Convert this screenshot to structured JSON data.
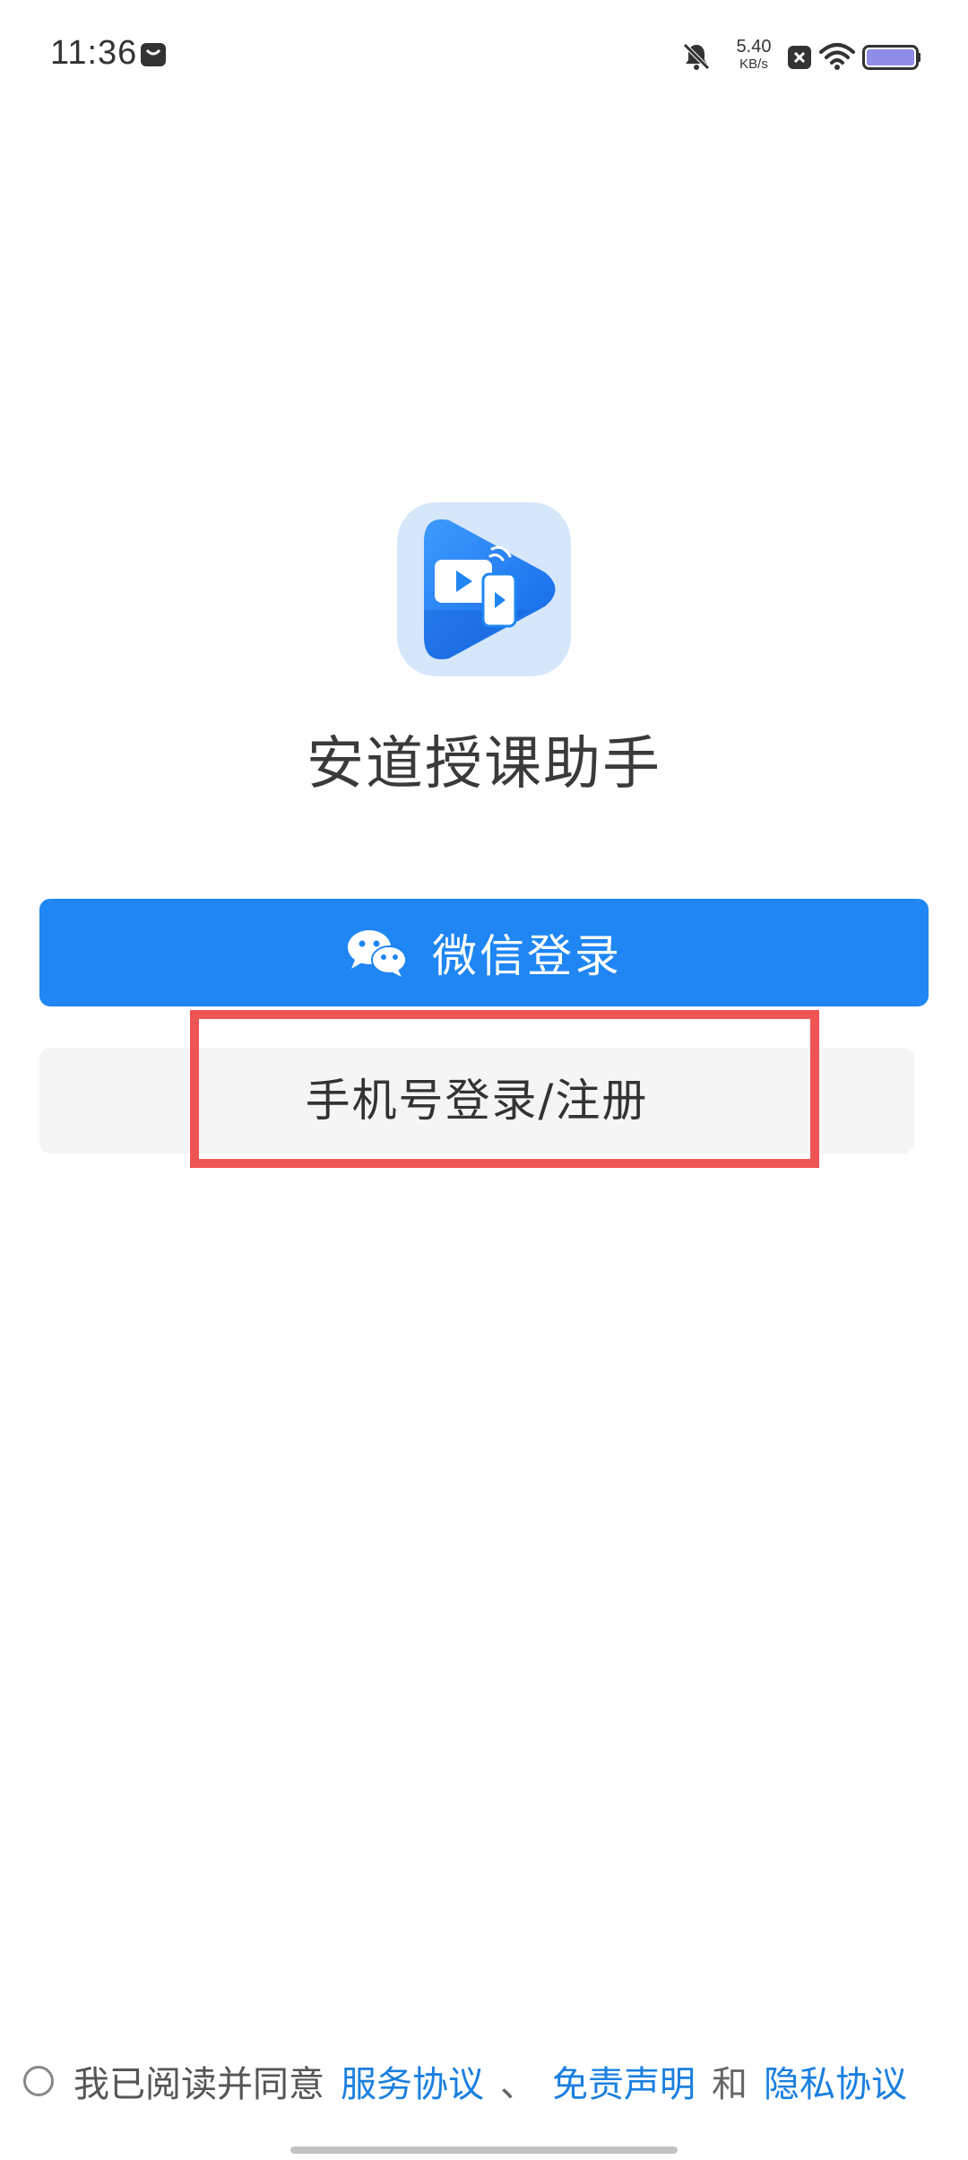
{
  "status_bar": {
    "time": "11:36",
    "net_speed_value": "5.40",
    "net_speed_unit": "KB/s",
    "icons": [
      "notification-bag-icon",
      "mute-bell-icon",
      "close-box-icon",
      "wifi-icon",
      "battery-icon"
    ]
  },
  "app": {
    "name": "安道授课助手",
    "logo": "app-logo-icon"
  },
  "buttons": {
    "wechat_login": "微信登录",
    "phone_login": "手机号登录/注册"
  },
  "agreement": {
    "prefix": "我已阅读并同意",
    "service": "服务协议",
    "separator": "、",
    "disclaimer": "免责声明",
    "and": "和",
    "privacy": "隐私协议"
  },
  "colors": {
    "primary": "#1f86f4",
    "link": "#1a7fe0",
    "highlight": "#ee5454",
    "secondary_button": "#f5f5f5"
  }
}
